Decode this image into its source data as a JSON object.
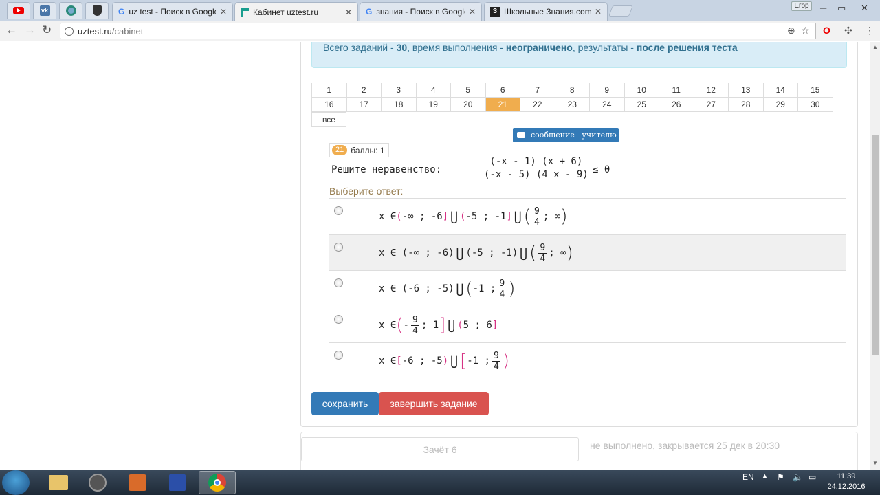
{
  "browser": {
    "tabs": [
      {
        "label": "uz test - Поиск в Google",
        "active": false
      },
      {
        "label": "Кабинет uztest.ru",
        "active": true
      },
      {
        "label": "знания - Поиск в Google",
        "active": false
      },
      {
        "label": "Школьные Знания.com",
        "active": false
      }
    ],
    "user_badge": "Егор",
    "url_host": "uztest.ru",
    "url_path": "/cabinet"
  },
  "info": {
    "prefix": "Всего заданий - ",
    "total": "30",
    "mid1": ", время выполнения - ",
    "time": "неограничено",
    "mid2": ", результаты - ",
    "results": "после решения теста"
  },
  "grid": {
    "row1": [
      "1",
      "2",
      "3",
      "4",
      "5",
      "6",
      "7",
      "8",
      "9",
      "10",
      "11",
      "12",
      "13",
      "14",
      "15"
    ],
    "row2": [
      "16",
      "17",
      "18",
      "19",
      "20",
      "21",
      "22",
      "23",
      "24",
      "25",
      "26",
      "27",
      "28",
      "29",
      "30"
    ],
    "current": "21",
    "all_label": "все"
  },
  "message_button": "сообщение   учителю",
  "question": {
    "number": "21",
    "points": "баллы: 1",
    "text": "Решите неравенство:",
    "numerator": "(-x - 1) (x + 6)",
    "denominator": "(-x - 5) (4 x - 9)",
    "relation": "≤ 0"
  },
  "choose_label": "Выберите ответ:",
  "answers": [
    {
      "text": "x ∈ (-∞ ; -6] ⋃ (-5 ; -1] ⋃ (9/4 ; ∞)"
    },
    {
      "text": "x ∈ (-∞ ; -6) ⋃ (-5 ; -1) ⋃ (9/4 ; ∞)"
    },
    {
      "text": "x ∈ (-6 ; -5) ⋃ (-1 ; 9/4)"
    },
    {
      "text": "x ∈ (-9/4 ; 1] ⋃ (5 ; 6]"
    },
    {
      "text": "x ∈ [-6 ; -5) ⋃ [-1 ; 9/4)"
    }
  ],
  "buttons": {
    "save": "сохранить",
    "finish": "завершить задание"
  },
  "next_test": {
    "title": "Зачёт 6",
    "status": "не выполнено, закрывается 25 дек в 20:30"
  },
  "taskbar": {
    "lang": "EN",
    "time": "11:39",
    "date": "24.12.2016"
  }
}
